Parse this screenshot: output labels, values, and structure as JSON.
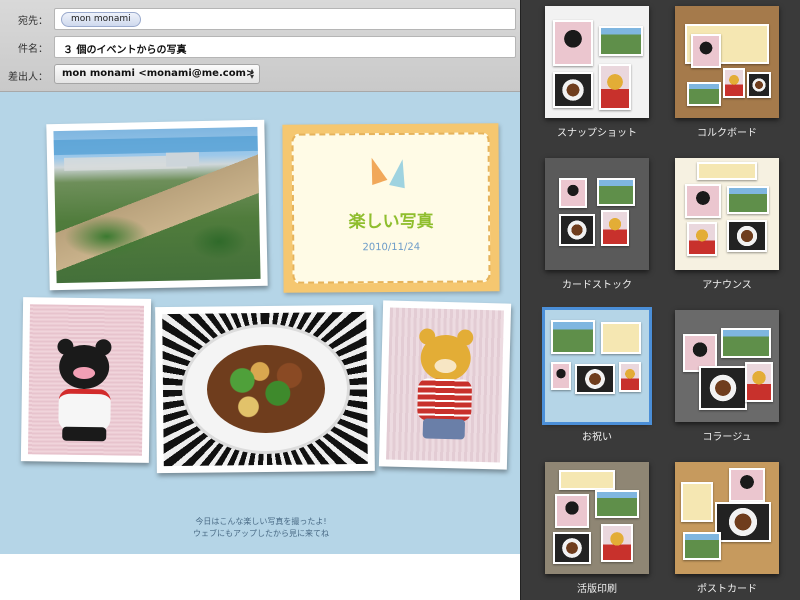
{
  "header": {
    "to_label": "宛先：",
    "to_recipient": "mon monami",
    "subject_label": "件名：",
    "subject_value": "３ 個のイベントからの写真",
    "from_label": "差出人：",
    "from_value": "mon monami <monami@me.com>"
  },
  "stationery": {
    "card_title": "楽しい写真",
    "card_date": "2010/11/24",
    "message_line1": "今日はこんな楽しい写真を撮ったよ!",
    "message_line2": "ウェブにもアップしたから見に来てね"
  },
  "templates": [
    {
      "label": "スナップショット",
      "bg": "#f2f2f2"
    },
    {
      "label": "コルクボード",
      "bg": "#a57a4b"
    },
    {
      "label": "カードストック",
      "bg": "#5a5a5a"
    },
    {
      "label": "アナウンス",
      "bg": "#f6f1e1"
    },
    {
      "label": "お祝い",
      "bg": "#b5d5e7"
    },
    {
      "label": "コラージュ",
      "bg": "#6a6a6a"
    },
    {
      "label": "活版印刷",
      "bg": "#8f8674"
    },
    {
      "label": "ポストカード",
      "bg": "#c69a5e"
    }
  ],
  "selected_template": "お祝い",
  "colors": {
    "canvas_bg": "#b5d5e7",
    "card_title": "#8fbe2e",
    "selection": "#4b8fd8",
    "panel_bg": "#3a3a3a"
  }
}
